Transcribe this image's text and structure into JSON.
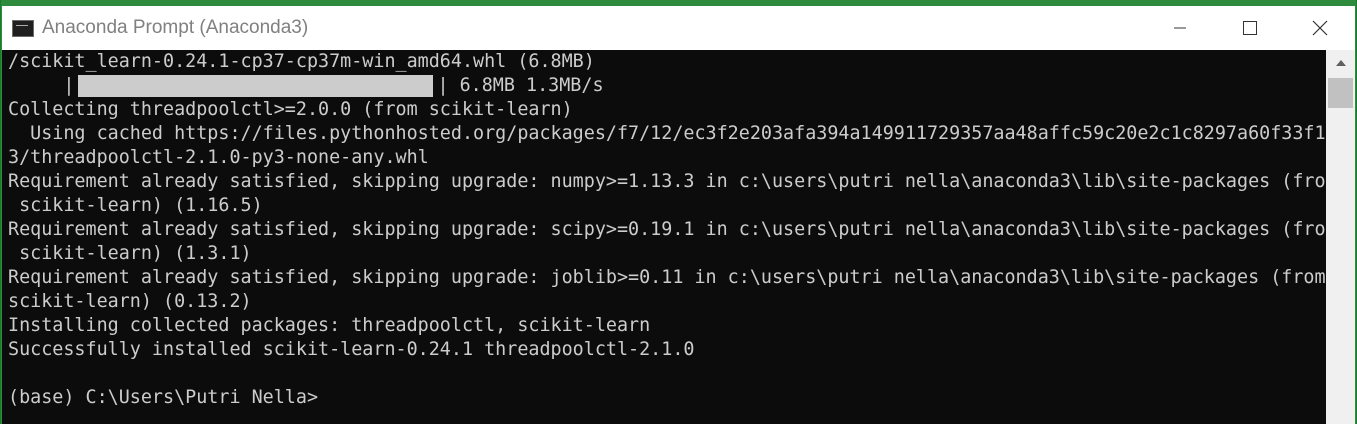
{
  "window": {
    "title": "Anaconda Prompt (Anaconda3)",
    "icons": {
      "app": "console-app-icon",
      "minimize": "minimize-icon",
      "maximize": "maximize-icon",
      "close": "close-icon",
      "scroll_up": "scroll-up-arrow-icon"
    }
  },
  "console": {
    "lines": [
      "/scikit_learn-0.24.1-cp37-cp37m-win_amd64.whl (6.8MB)",
      "",
      "Collecting threadpoolctl>=2.0.0 (from scikit-learn)",
      "  Using cached https://files.pythonhosted.org/packages/f7/12/ec3f2e203afa394a149911729357aa48affc59c20e2c1c8297a60f33f13",
      "3/threadpoolctl-2.1.0-py3-none-any.whl",
      "Requirement already satisfied, skipping upgrade: numpy>=1.13.3 in c:\\users\\putri nella\\anaconda3\\lib\\site-packages (from",
      " scikit-learn) (1.16.5)",
      "Requirement already satisfied, skipping upgrade: scipy>=0.19.1 in c:\\users\\putri nella\\anaconda3\\lib\\site-packages (from",
      " scikit-learn) (1.3.1)",
      "Requirement already satisfied, skipping upgrade: joblib>=0.11 in c:\\users\\putri nella\\anaconda3\\lib\\site-packages (from",
      "scikit-learn) (0.13.2)",
      "Installing collected packages: threadpoolctl, scikit-learn",
      "Successfully installed scikit-learn-0.24.1 threadpoolctl-2.1.0",
      "",
      "(base) C:\\Users\\Putri Nella>"
    ],
    "progress": {
      "prefix": "     |",
      "suffix": "| 6.8MB 1.3MB/s",
      "fraction": 1.0
    }
  },
  "colors": {
    "console_bg": "#0c0c0c",
    "console_text": "#cccccc",
    "titlebar_bg": "#ffffff",
    "title_text": "#808080",
    "window_border": "#2e8b3d"
  }
}
